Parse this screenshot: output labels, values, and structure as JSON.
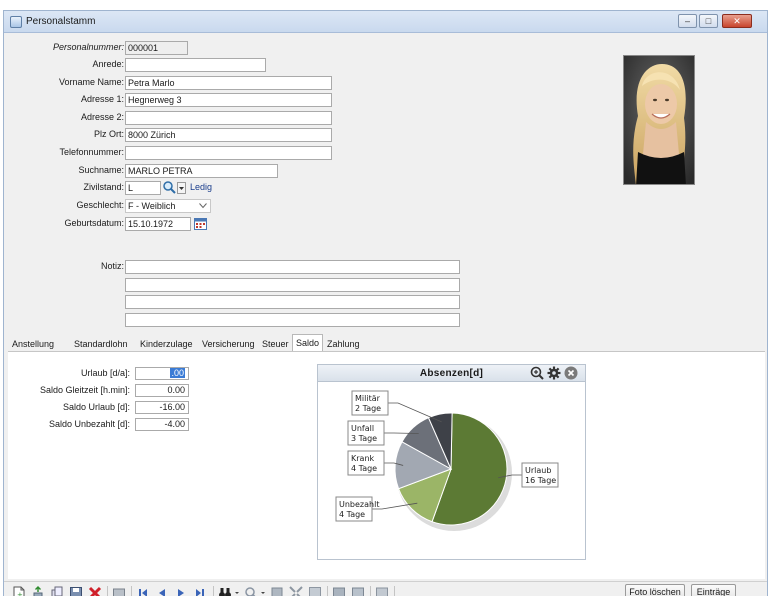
{
  "window": {
    "title": "Personalstamm"
  },
  "form": {
    "personalnummer": {
      "label": "Personalnummer:",
      "value": "000001"
    },
    "anrede": {
      "label": "Anrede:",
      "value": ""
    },
    "vorname_name": {
      "label": "Vorname Name:",
      "value": "Petra Marlo"
    },
    "adresse1": {
      "label": "Adresse 1:",
      "value": "Hegnerweg 3"
    },
    "adresse2": {
      "label": "Adresse 2:",
      "value": ""
    },
    "plz_ort": {
      "label": "Plz Ort:",
      "value": "8000 Zürich"
    },
    "telefon": {
      "label": "Telefonnummer:",
      "value": ""
    },
    "suchname": {
      "label": "Suchname:",
      "value": "MARLO PETRA"
    },
    "zivilstand": {
      "label": "Zivilstand:",
      "value": "L",
      "text": "Ledig"
    },
    "geschlecht": {
      "label": "Geschlecht:",
      "value": "F - Weiblich"
    },
    "geburtsdatum": {
      "label": "Geburtsdatum:",
      "value": "15.10.1972"
    },
    "notiz": {
      "label": "Notiz:",
      "lines": [
        "",
        "",
        "",
        ""
      ]
    }
  },
  "tabs": [
    "Anstellung",
    "Standardlohn",
    "Kinderzulage",
    "Versicherung",
    "Steuer",
    "Saldo",
    "Zahlung"
  ],
  "active_tab": "Saldo",
  "saldo": {
    "urlaub": {
      "label": "Urlaub [d/a]:",
      "value": ".00"
    },
    "gleitzeit": {
      "label": "Saldo Gleitzeit [h.min]:",
      "value": "0.00"
    },
    "saldo_urlaub": {
      "label": "Saldo Urlaub [d]:",
      "value": "-16.00"
    },
    "unbezahlt": {
      "label": "Saldo Unbezahlt [d]:",
      "value": "-4.00"
    }
  },
  "chart_data": {
    "type": "pie",
    "title": "Absenzen[d]",
    "slices": [
      {
        "name": "Urlaub",
        "label": "16 Tage",
        "value": 16,
        "color": "#5c7a34"
      },
      {
        "name": "Unbezahlt",
        "label": "4 Tage",
        "value": 4,
        "color": "#9bb567"
      },
      {
        "name": "Krank",
        "label": "4 Tage",
        "value": 4,
        "color": "#a2a8b2"
      },
      {
        "name": "Unfall",
        "label": "3 Tage",
        "value": 3,
        "color": "#6c7079"
      },
      {
        "name": "Militär",
        "label": "2 Tage",
        "value": 2,
        "color": "#3e4148"
      }
    ]
  },
  "buttons": {
    "foto_loeschen": "Foto löschen",
    "eintraege": "Einträge"
  },
  "window_controls": {
    "minimize": "–",
    "maximize": "□",
    "close": "✕"
  }
}
